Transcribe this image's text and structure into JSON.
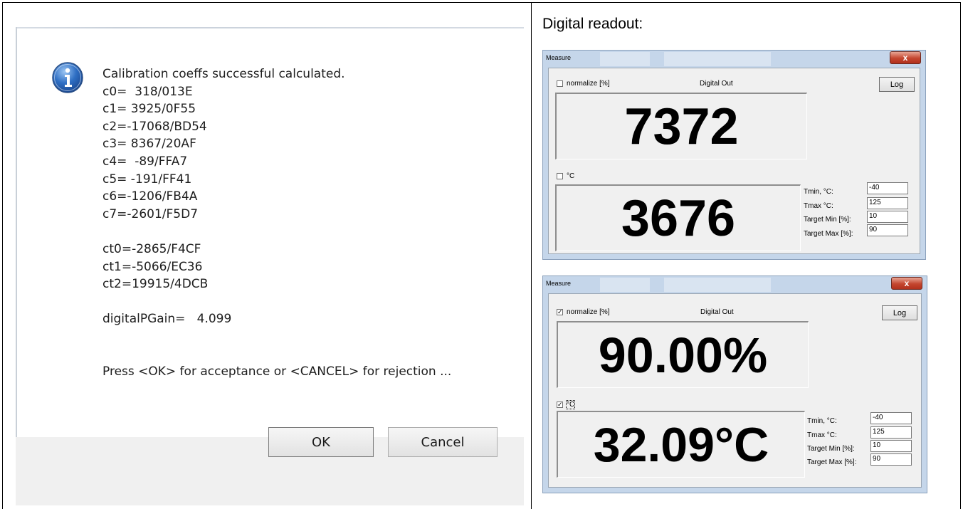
{
  "dialog": {
    "icon": "info-icon",
    "lines": [
      "Calibration coeffs successful calculated.",
      "c0=  318/013E",
      "c1= 3925/0F55",
      "c2=-17068/BD54",
      "c3= 8367/20AF",
      "c4=  -89/FFA7",
      "c5= -191/FF41",
      "c6=-1206/FB4A",
      "c7=-2601/F5D7"
    ],
    "ct_lines": [
      "ct0=-2865/F4CF",
      "ct1=-5066/EC36",
      "ct2=19915/4DCB"
    ],
    "gain_line": "digitalPGain=   4.099",
    "prompt": "Press <OK> for acceptance or <CANCEL> for rejection ...",
    "ok_label": "OK",
    "cancel_label": "Cancel"
  },
  "right": {
    "title": "Digital readout:",
    "windows": [
      {
        "title": "Measure",
        "close_label": "x",
        "normalize_label": "normalize [%]",
        "normalize_checked": false,
        "digital_out_label": "Digital Out",
        "log_label": "Log",
        "main_value": "7372",
        "celsius_label": "°C",
        "celsius_checked": false,
        "second_value": "3676",
        "fields": [
          {
            "label": "Tmin, °C:",
            "value": "-40"
          },
          {
            "label": "Tmax °C:",
            "value": "125"
          },
          {
            "label": "Target Min [%]:",
            "value": "10"
          },
          {
            "label": "Target Max [%]:",
            "value": "90"
          }
        ]
      },
      {
        "title": "Measure",
        "close_label": "x",
        "normalize_label": "normalize [%]",
        "normalize_checked": true,
        "digital_out_label": "Digital Out",
        "log_label": "Log",
        "main_value": "90.00%",
        "celsius_label": "°C",
        "celsius_checked": true,
        "second_value": "32.09°C",
        "fields": [
          {
            "label": "Tmin, °C:",
            "value": "-40"
          },
          {
            "label": "Tmax °C:",
            "value": "125"
          },
          {
            "label": "Target Min [%]:",
            "value": "10"
          },
          {
            "label": "Target Max [%]:",
            "value": "90"
          }
        ]
      }
    ]
  }
}
